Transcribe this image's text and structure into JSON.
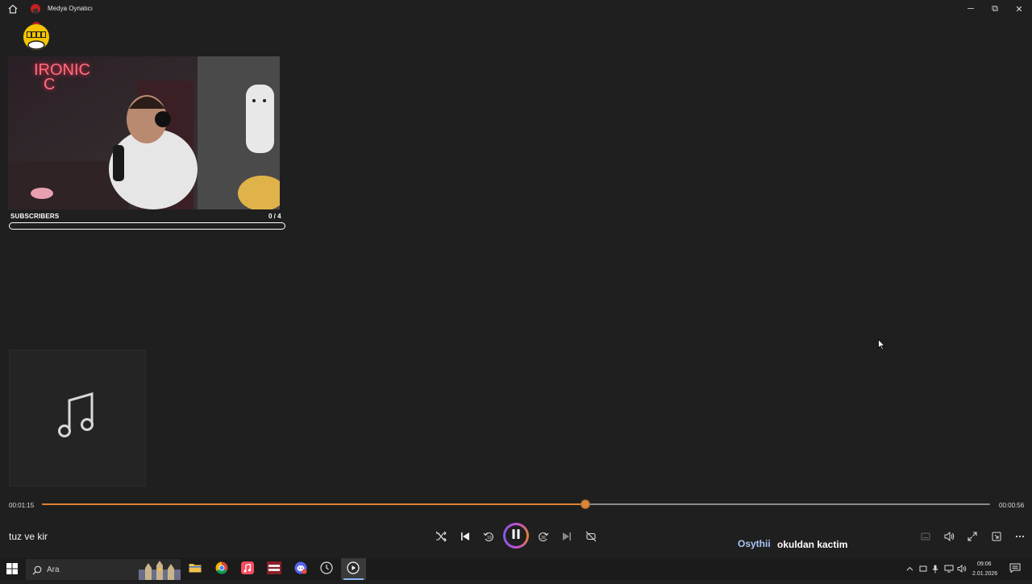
{
  "window": {
    "title": "Medya Oynatıcı",
    "minimize_glyph": "─",
    "maximize_glyph": "⧉",
    "close_glyph": "✕"
  },
  "overlay": {
    "neon_sign_lines": [
      "IR",
      "ONIC",
      "C"
    ],
    "subscribers_label": "SUBSCRIBERS",
    "subscribers_count": "0 / 4",
    "subscribers_progress": 0
  },
  "player": {
    "time_elapsed": "00:01:15",
    "time_remaining": "00:00:56",
    "progress_fraction": 0.573,
    "track_title": "tuz ve kir",
    "colors": {
      "accent": "#e0822f",
      "background": "#1f1f1f"
    }
  },
  "chat": {
    "user": "Osythii",
    "message": "okuldan kactim"
  },
  "taskbar": {
    "search_placeholder": "Ara",
    "clock_time": "09:06",
    "clock_date": "2.01.2026",
    "apps": [
      "file-explorer-icon",
      "chrome-icon",
      "music-icon",
      "voicemeeter-icon",
      "discord-icon",
      "clock-app-icon",
      "media-player-icon"
    ],
    "tray_icons": [
      "chevron-up-icon",
      "device-icon",
      "microphone-icon",
      "network-icon",
      "speaker-icon",
      "notification-icon"
    ]
  },
  "icons": {
    "home": "home-icon",
    "shuffle": "shuffle-icon",
    "previous": "skip-previous-icon",
    "rewind": "rewind-10-icon",
    "pause": "pause-icon",
    "forward": "forward-30-icon",
    "next": "skip-next-icon",
    "repeat": "repeat-off-icon",
    "subtitles": "subtitles-icon",
    "volume": "volume-icon",
    "fullscreen": "fullscreen-icon",
    "miniplayer": "miniplayer-icon",
    "more": "more-icon",
    "album_placeholder": "music-note-icon"
  }
}
